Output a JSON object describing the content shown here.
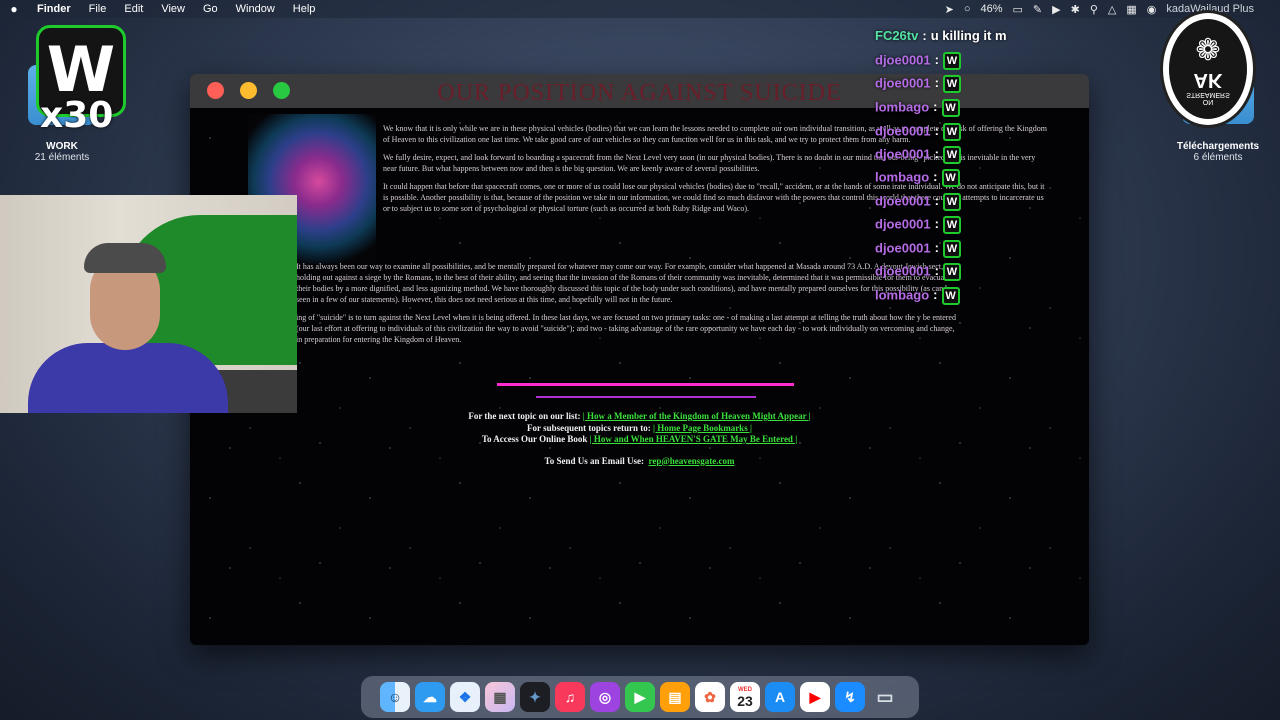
{
  "menubar": {
    "apple": "",
    "app_name": "Finder",
    "items": [
      "File",
      "Edit",
      "View",
      "Go",
      "Window",
      "Help"
    ],
    "battery": "46%",
    "user": "kadaWailaud Plus"
  },
  "desktop": {
    "work_folder": {
      "name": "WORK",
      "count": "21 éléments"
    },
    "downloads_folder": {
      "name": "Téléchargements",
      "count": "6 éléments"
    },
    "w_logo": {
      "letter": "W",
      "multiplier": "x30"
    },
    "ak_logo": {
      "letters": "AK",
      "sub": "STREAMERS",
      "sub2": "ON"
    }
  },
  "browser": {
    "page_heading": "OUR POSITION AGAINST SUICIDE",
    "paragraphs": [
      "We know that it is only while we are in these physical vehicles (bodies) that we can learn the lessons needed to complete our own individual transition, as well as to complete our task of offering the Kingdom of Heaven to this civilization one last time. We take good care of our vehicles so they can function well for us in this task, and we try to protect them from any harm.",
      "We fully desire, expect, and look forward to boarding a spacecraft from the Next Level very soon (in our physical bodies). There is no doubt in our mind that our being \"picked up\" is inevitable in the very near future. But what happens between now and then is the big question. We are keenly aware of several possibilities.",
      "It could happen that before that spacecraft comes, one or more of us could lose our physical vehicles (bodies) due to \"recall,\" accident, or at the hands of some irate individual. We do not anticipate this, but it is possible. Another possibility is that, because of the position we take in our information, we could find so much disfavor with the powers that control this world that there could be attempts to incarcerate us or to subject us to some sort of psychological or physical torture (such as occurred at both Ruby Ridge and Waco).",
      "It has always been our way to examine all possibilities, and be mentally prepared for whatever may come our way. For example, consider what happened at Masada around 73 A.D. A devout Jewish sect, after holding out against a siege by the Romans, to the best of their ability, and seeing that the invasion of the Romans of their community was inevitable, determined that it was permissible for them to evacuate their bodies by a more dignified, and less agonizing method. We have thoroughly discussed this topic of the body under such conditions), and have mentally prepared ourselves for this possibility (as can be seen in a few of our statements). However, this does not need serious at this time, and hopefully will not in the future.",
      "ing of \"suicide\" is to turn against the Next Level when it is being offered. In these last days, we are focused on two primary tasks: one - of making a last attempt at telling the truth about how the y be entered (our last effort at offering to individuals of this civilization the way to avoid \"suicide\"); and two - taking advantage of the rare opportunity we have each day - to work individually on vercoming and change, in preparation for entering the Kingdom of Heaven."
    ],
    "footer": {
      "next_label": "For the next topic on our list:",
      "next_link": "| How a Member of the Kingdom of Heaven Might Appear |",
      "subsequent_label": "For subsequent topics return to:",
      "subsequent_link": "| Home Page Bookmarks |",
      "book_label": "To Access Our Online Book",
      "book_link": "| How and When HEAVEN'S GATE May Be Entered |",
      "email_label": "To Send Us an Email Use:",
      "email_link": "rep@heavensgate.com"
    }
  },
  "chat": [
    {
      "user": "FC26tv",
      "message": "u killing it m"
    },
    {
      "user": "djoe0001",
      "message": "W"
    },
    {
      "user": "djoe0001",
      "message": "W"
    },
    {
      "user": "lombago",
      "message": "W"
    },
    {
      "user": "djoe0001",
      "message": "W"
    },
    {
      "user": "djoe0001",
      "message": "W"
    },
    {
      "user": "lombago",
      "message": "W"
    },
    {
      "user": "djoe0001",
      "message": "W"
    },
    {
      "user": "djoe0001",
      "message": "W"
    },
    {
      "user": "djoe0001",
      "message": "W"
    },
    {
      "user": "djoe0001",
      "message": "W"
    },
    {
      "user": "lombago",
      "message": "W"
    }
  ],
  "dock": {
    "apps": [
      "finder-icon",
      "files-icon",
      "safari-icon",
      "launchpad-icon",
      "davinci-icon",
      "music-icon",
      "podcasts-icon",
      "facetime-icon",
      "books-icon",
      "photos-icon",
      "calendar-icon",
      "appstore-icon",
      "youtube-icon",
      "messenger-icon",
      "trash-icon"
    ],
    "calendar_month": "WED",
    "calendar_day": "23"
  },
  "colors": {
    "heading": "#6a1e2a",
    "link_green": "#3ae03a",
    "rule_pink": "#ff2bd1",
    "chat_user": "#b56ce6",
    "chat_user_first": "#54e0a2",
    "badge_border": "#1ecb2d"
  }
}
